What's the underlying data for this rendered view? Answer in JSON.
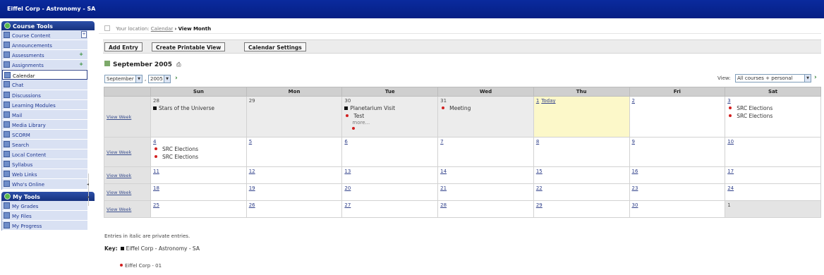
{
  "app": {
    "title": "Eiffel Corp - Astronomy - SA"
  },
  "sidebar": {
    "course_tools_header": "Course Tools",
    "course_tools": [
      {
        "label": "Course Content",
        "icon": "folder-icon"
      },
      {
        "label": "Announcements",
        "icon": "announcement-icon"
      },
      {
        "label": "Assessments",
        "icon": "assessment-icon",
        "badge": "+"
      },
      {
        "label": "Assignments",
        "icon": "assignment-icon",
        "badge": "+"
      },
      {
        "label": "Calendar",
        "icon": "calendar-icon",
        "active": true
      },
      {
        "label": "Chat",
        "icon": "chat-icon"
      },
      {
        "label": "Discussions",
        "icon": "discussion-icon"
      },
      {
        "label": "Learning Modules",
        "icon": "module-icon"
      },
      {
        "label": "Mail",
        "icon": "mail-icon"
      },
      {
        "label": "Media Library",
        "icon": "media-icon"
      },
      {
        "label": "SCORM",
        "icon": "scorm-icon"
      },
      {
        "label": "Search",
        "icon": "search-icon"
      },
      {
        "label": "Local Content",
        "icon": "local-content-icon"
      },
      {
        "label": "Syllabus",
        "icon": "syllabus-icon"
      },
      {
        "label": "Web Links",
        "icon": "web-links-icon"
      },
      {
        "label": "Who's Online",
        "icon": "whos-online-icon"
      }
    ],
    "my_tools_header": "My Tools",
    "my_tools": [
      {
        "label": "My Grades",
        "icon": "grades-icon"
      },
      {
        "label": "My Files",
        "icon": "files-icon"
      },
      {
        "label": "My Progress",
        "icon": "progress-icon"
      }
    ]
  },
  "location": {
    "prefix": "Your location:",
    "link": "Calendar",
    "separator": "›",
    "current": "View Month"
  },
  "toolbar": {
    "add_entry": "Add Entry",
    "printable": "Create Printable View",
    "settings": "Calendar Settings"
  },
  "month_title": "September 2005",
  "month_select": "September",
  "year_select": "2005",
  "date_separator": ",",
  "view": {
    "label": "View:",
    "value": "All courses + personal"
  },
  "calendar": {
    "days": [
      "Sun",
      "Mon",
      "Tue",
      "Wed",
      "Thu",
      "Fri",
      "Sat"
    ],
    "view_week": "View Week",
    "weeks": [
      [
        {
          "day": "28",
          "events": [
            {
              "type": "course",
              "text": "Stars of the Universe"
            }
          ]
        },
        {
          "day": "29"
        },
        {
          "day": "30",
          "events": [
            {
              "type": "course",
              "text": "Planetarium Visit"
            },
            {
              "type": "personal",
              "text": "Test"
            }
          ],
          "more": "more..."
        },
        {
          "day": "31",
          "events": [
            {
              "type": "personal",
              "text": "Meeting"
            }
          ]
        },
        {
          "day": "1",
          "today": "Today",
          "events": []
        },
        {
          "day": "2"
        },
        {
          "day": "3",
          "events": [
            {
              "type": "personal",
              "text": "SRC Elections"
            },
            {
              "type": "personal",
              "text": "SRC Elections"
            }
          ]
        }
      ],
      [
        {
          "day": "4",
          "events": [
            {
              "type": "personal",
              "text": "SRC Elections"
            },
            {
              "type": "personal",
              "text": "SRC Elections"
            }
          ]
        },
        {
          "day": "5"
        },
        {
          "day": "6"
        },
        {
          "day": "7"
        },
        {
          "day": "8"
        },
        {
          "day": "9"
        },
        {
          "day": "10"
        }
      ],
      [
        {
          "day": "11"
        },
        {
          "day": "12"
        },
        {
          "day": "13"
        },
        {
          "day": "14"
        },
        {
          "day": "15"
        },
        {
          "day": "16"
        },
        {
          "day": "17"
        }
      ],
      [
        {
          "day": "18"
        },
        {
          "day": "19"
        },
        {
          "day": "20"
        },
        {
          "day": "21"
        },
        {
          "day": "22"
        },
        {
          "day": "23"
        },
        {
          "day": "24"
        }
      ],
      [
        {
          "day": "25"
        },
        {
          "day": "26"
        },
        {
          "day": "27"
        },
        {
          "day": "28"
        },
        {
          "day": "29"
        },
        {
          "day": "30"
        },
        {
          "day": "1"
        }
      ]
    ]
  },
  "footnote": "Entries in italic are private entries.",
  "key": {
    "label": "Key:",
    "course_entry": "Eiffel Corp - Astronomy - SA",
    "personal_entry": "Eiffel Corp - 01"
  },
  "colors": {
    "topbar": "#0a2a9e",
    "sidebar_item_bg": "#d9e1f3",
    "today_bg": "#fcf8c9",
    "personal_dot": "#d32020"
  }
}
